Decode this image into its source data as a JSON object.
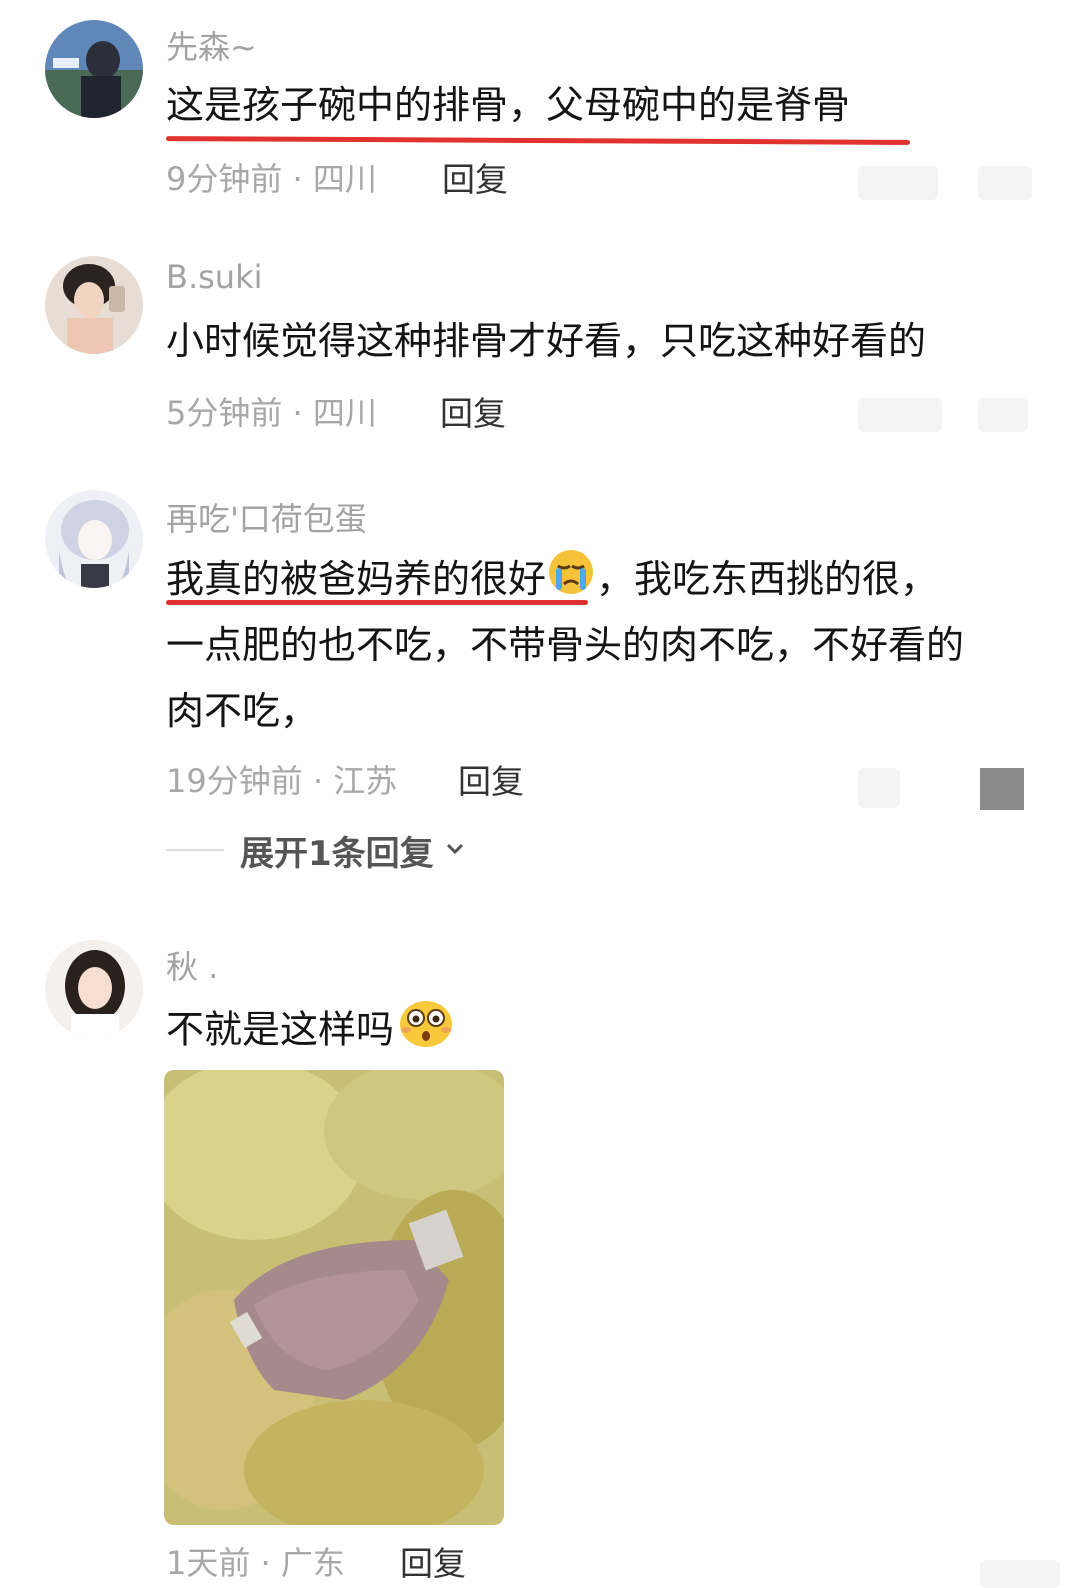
{
  "comments": [
    {
      "username": "先森~",
      "text": "这是孩子碗中的排骨，父母碗中的是脊骨",
      "time": "9分钟前 · 四川",
      "reply": "回复"
    },
    {
      "username": "B.suki",
      "text": "小时候觉得这种排骨才好看，只吃这种好看的",
      "time": "5分钟前 · 四川",
      "reply": "回复"
    },
    {
      "username": "再吃'口荷包蛋",
      "text_part1": "我真的被爸妈养的很好",
      "text_part2": "，我吃东西挑的很，",
      "text_line2": "一点肥的也不吃，不带骨头的肉不吃，不好看的",
      "text_line3": "肉不吃，",
      "time": "19分钟前 · 江苏",
      "reply": "回复",
      "expand_label": "展开1条回复"
    },
    {
      "username": "秋 .",
      "text": "不就是这样吗",
      "time": "1天前 · 广东",
      "reply": "回复"
    }
  ],
  "colors": {
    "underline": "#e0322f",
    "username": "#a3a3a3",
    "meta": "#a8a8a8"
  },
  "icons": [
    "crying-emoji-icon",
    "surprised-emoji-icon",
    "chevron-down-icon"
  ]
}
